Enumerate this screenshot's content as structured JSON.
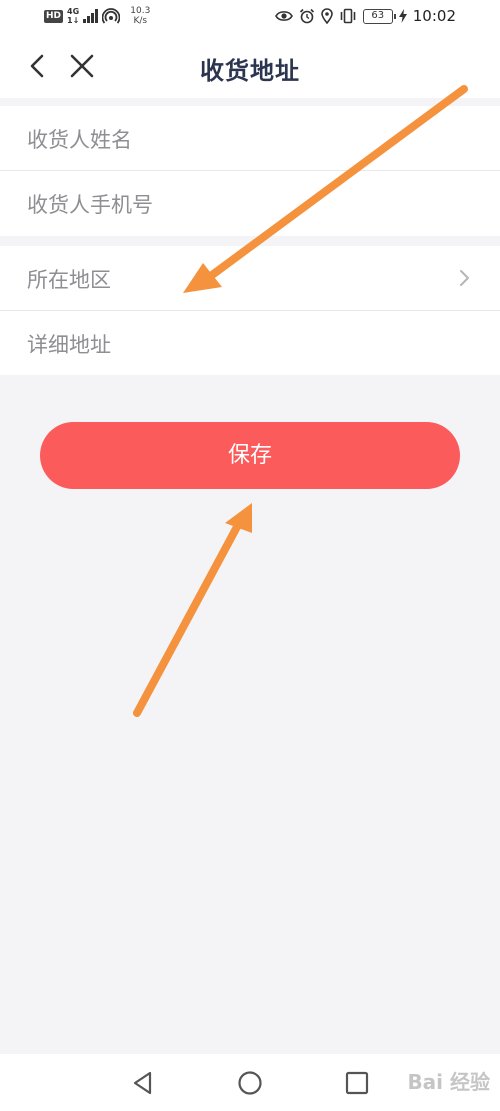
{
  "status_bar": {
    "hd": "HD",
    "network_top": "4G",
    "network_bottom": "1↓",
    "speed_value": "10.3",
    "speed_unit": "K/s",
    "battery": "63",
    "time": "10:02"
  },
  "header": {
    "title": "收货地址"
  },
  "form": {
    "name_label": "收货人姓名",
    "phone_label": "收货人手机号",
    "region_label": "所在地区",
    "address_label": "详细地址"
  },
  "save_label": "保存",
  "watermark": "Bai 经验",
  "colors": {
    "accent": "#fb5b5b",
    "title": "#2c3550",
    "placeholder": "#8e8e93",
    "background": "#f4f4f6",
    "annotation_arrow": "#f5923e"
  }
}
